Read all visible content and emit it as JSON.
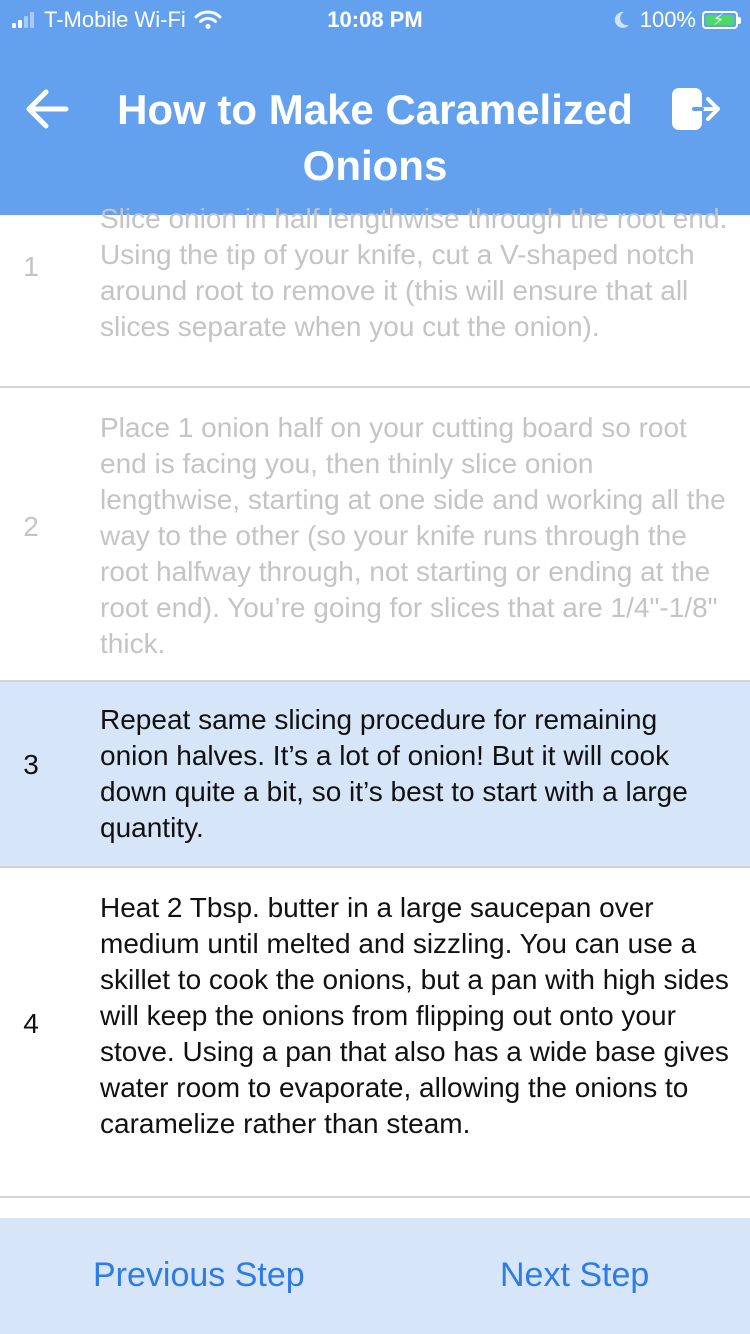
{
  "status_bar": {
    "carrier": "T-Mobile Wi-Fi",
    "time": "10:08 PM",
    "battery": "100%",
    "icons": [
      "signal-icon",
      "wifi-icon",
      "moon-icon",
      "battery-charging-icon"
    ]
  },
  "header": {
    "title": "How to Make Caramelized Onions",
    "back_icon": "arrow-left-icon",
    "exit_icon": "exit-icon"
  },
  "steps": [
    {
      "number": "1",
      "text": "Slice onion in half lengthwise through the root end. Using the tip of your knife, cut a V-shaped notch around root to remove it (this will ensure that all slices separate when you cut the onion).",
      "state": "faded"
    },
    {
      "number": "2",
      "text": "Place 1 onion half on your cutting board so root end is facing you, then thinly slice onion lengthwise, starting at one side and working all the way to the other (so your knife runs through the root halfway through, not starting or ending at the root end). You’re going for slices that are 1/4\"-1/8\" thick.",
      "state": "faded"
    },
    {
      "number": "3",
      "text": "Repeat same slicing procedure for remaining onion halves. It’s a lot of onion! But it will cook down quite a bit, so it’s best to start with a large quantity.",
      "state": "current"
    },
    {
      "number": "4",
      "text": "Heat 2 Tbsp. butter in a large saucepan over medium until melted and sizzling. You can use a skillet to cook the onions, but a pan with high sides will keep the onions from flipping out onto your stove. Using a pan that also has a wide base gives water room to evaporate, allowing the onions to caramelize rather than steam.",
      "state": "normal"
    }
  ],
  "bottom_bar": {
    "previous_label": "Previous Step",
    "next_label": "Next Step"
  },
  "colors": {
    "header_bg": "#63a1ee",
    "highlight_bg": "#d6e5f8",
    "link": "#2f7be6",
    "faded_text": "#c4c4c4",
    "battery_green": "#4cd964"
  }
}
